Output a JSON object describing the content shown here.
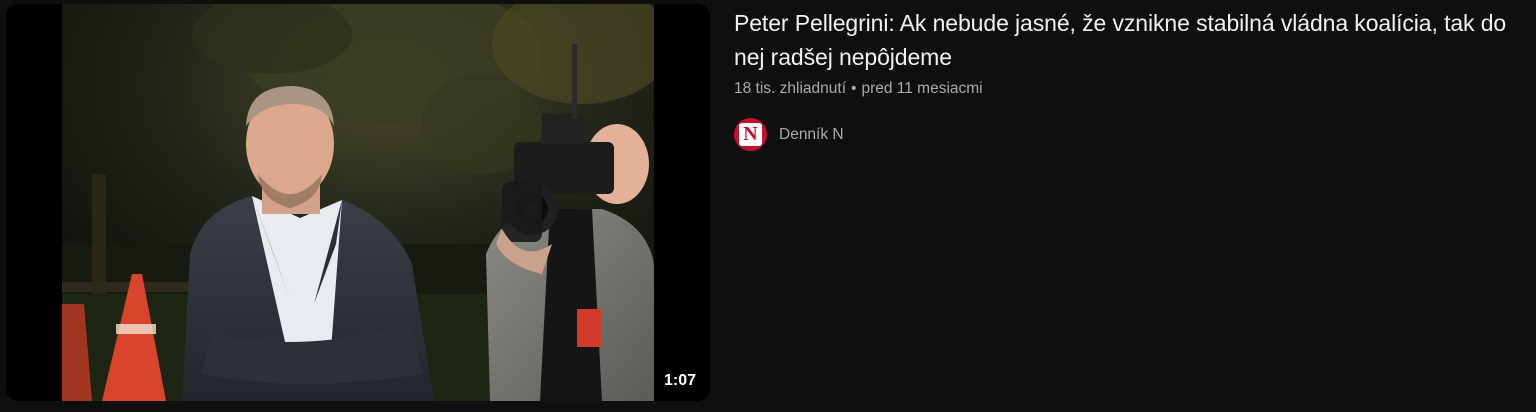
{
  "video": {
    "title": "Peter Pellegrini: Ak nebude jasné, že vznikne stabilná vládna koalícia, tak do nej radšej nepôjdeme",
    "duration": "1:07",
    "views": "18 tis. zhliadnutí",
    "separator": "•",
    "age": "pred 11 mesiacmi"
  },
  "channel": {
    "name": "Denník N",
    "avatar_letter": "N",
    "avatar_color": "#c3102f"
  },
  "thumbnail": {
    "description_icon": "video-thumbnail"
  }
}
